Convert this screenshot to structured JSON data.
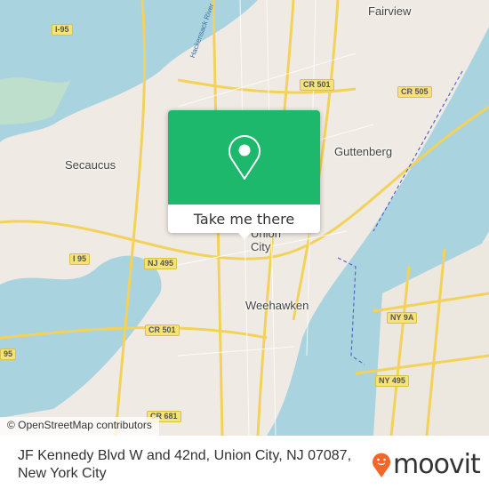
{
  "map": {
    "attribution": "© OpenStreetMap contributors",
    "places": [
      "Fairview",
      "Secaucus",
      "Guttenberg",
      "Union City",
      "Weehawken"
    ],
    "water_label": "Hackensack River",
    "shields": [
      "I-95",
      "CR 501",
      "CR 505",
      "NJ 495",
      "I 95",
      "CR 501",
      "NY 9A",
      "NY 495",
      "95",
      "CR 681"
    ],
    "colors": {
      "land": "#efebe4",
      "water": "#a9d3df",
      "road": "#f6e27a",
      "park": "#cde8c0",
      "accent": "#1db86c"
    }
  },
  "popup": {
    "icon": "map-pin-icon",
    "button_label": "Take me there"
  },
  "footer": {
    "address_line1": "JF Kennedy Blvd W and 42nd, Union City, NJ 07087,",
    "address_line2": "New York City",
    "brand": "moovit",
    "brand_color": "#f2662a"
  }
}
